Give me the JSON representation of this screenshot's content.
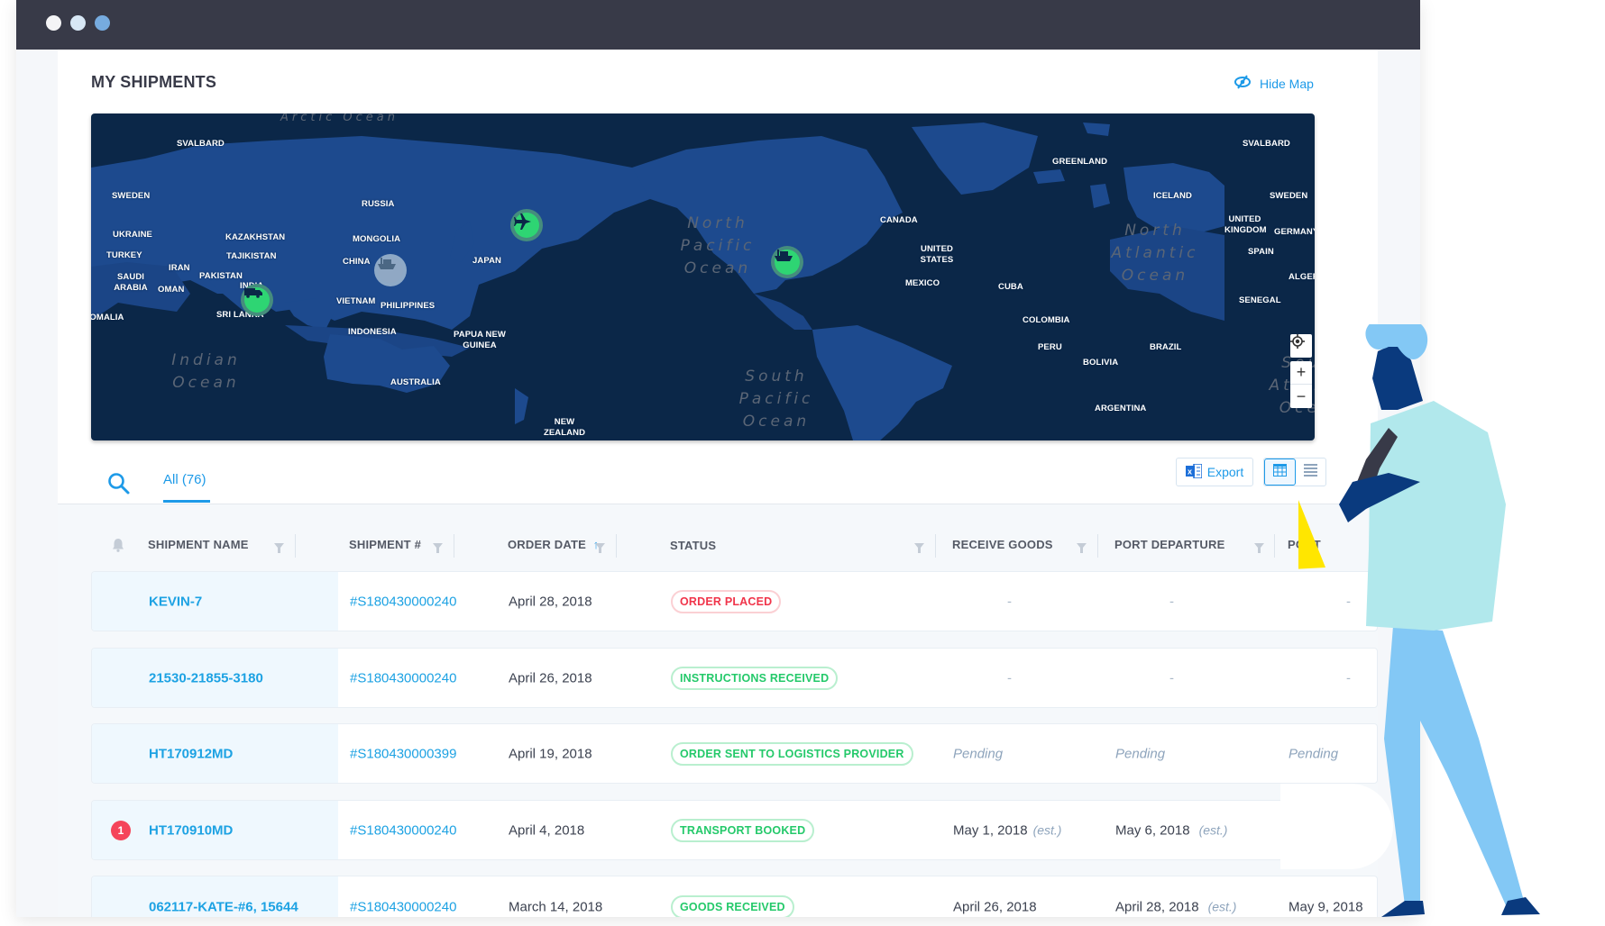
{
  "window": {
    "dots": [
      {
        "name": "window-dot-1",
        "color": "#f4f4f6"
      },
      {
        "name": "window-dot-2",
        "color": "#d7e7f5"
      },
      {
        "name": "window-dot-3",
        "color": "#76abdf"
      }
    ]
  },
  "header": {
    "title": "MY SHIPMENTS",
    "hide_map_label": "Hide Map",
    "hide_map_icon": "eye-slash-icon"
  },
  "map": {
    "country_labels": [
      "SVALBARD",
      "SWEDEN",
      "UKRAINE",
      "TURKEY",
      "IRAN",
      "SAUDI ARABIA",
      "OMAN",
      "SOMALIA",
      "KAZAKHSTAN",
      "TAJIKISTAN",
      "PAKISTAN",
      "INDIA",
      "SRI LANKA",
      "RUSSIA",
      "MONGOLIA",
      "CHINA",
      "JAPAN",
      "VIETNAM",
      "PHILIPPINES",
      "INDONESIA",
      "PAPUA NEW GUINEA",
      "AUSTRALIA",
      "NEW ZEALAND",
      "CANADA",
      "UNITED STATES",
      "MEXICO",
      "CUBA",
      "COLOMBIA",
      "PERU",
      "BOLIVIA",
      "BRAZIL",
      "ARGENTINA",
      "GREENLAND",
      "ICELAND",
      "SVALBARD",
      "SWEDEN",
      "UNITED KINGDOM",
      "GERMANY",
      "SPAIN",
      "ALGERIA",
      "SENEGAL"
    ],
    "ocean_labels": [
      "Arctic Ocean",
      "Indian Ocean",
      "North Pacific Ocean",
      "South Pacific Ocean",
      "North Atlantic Ocean",
      "South Atlantic Ocean"
    ],
    "markers": [
      {
        "type": "truck",
        "icon": "truck-icon",
        "state": "active",
        "near": "India"
      },
      {
        "type": "ship",
        "icon": "ship-icon",
        "state": "inactive",
        "near": "China"
      },
      {
        "type": "plane",
        "icon": "airplane-icon",
        "state": "active",
        "near": "Japan"
      },
      {
        "type": "ship",
        "icon": "ship-icon",
        "state": "active",
        "near": "North Pacific Ocean"
      }
    ],
    "controls": {
      "locate_icon": "crosshair-icon",
      "zoom_in": "+",
      "zoom_out": "−"
    }
  },
  "toolbar": {
    "search_icon": "search-icon",
    "tabs": [
      {
        "label": "All (76)",
        "active": true
      }
    ],
    "export_label": "Export",
    "export_icon": "excel-icon",
    "view_grid_icon": "grid-view-icon",
    "view_list_icon": "list-view-icon"
  },
  "table": {
    "columns": [
      "SHIPMENT NAME",
      "SHIPMENT #",
      "ORDER DATE",
      "STATUS",
      "RECEIVE GOODS",
      "PORT DEPARTURE",
      "PORT"
    ],
    "sort_indicator": "↑",
    "rows": [
      {
        "alert": null,
        "name": "KEVIN-7",
        "number": "#S180430000240",
        "order_date": "April 28, 2018",
        "status": "ORDER PLACED",
        "status_color": "red",
        "receive_goods": "-",
        "receive_est": "",
        "port_departure": "-",
        "port_departure_est": "",
        "port": "-"
      },
      {
        "alert": null,
        "name": "21530-21855-3180",
        "number": "#S180430000240",
        "order_date": "April 26, 2018",
        "status": "INSTRUCTIONS RECEIVED",
        "status_color": "green",
        "receive_goods": "-",
        "receive_est": "",
        "port_departure": "-",
        "port_departure_est": "",
        "port": "-"
      },
      {
        "alert": null,
        "name": "HT170912MD",
        "number": "#S180430000399",
        "order_date": "April 19, 2018",
        "status": "ORDER SENT TO LOGISTICS PROVIDER",
        "status_color": "green",
        "receive_goods": "Pending",
        "receive_est": "",
        "port_departure": "Pending",
        "port_departure_est": "",
        "port": "Pending"
      },
      {
        "alert": "1",
        "name": "HT170910MD",
        "number": "#S180430000240",
        "order_date": "April 4, 2018",
        "status": "TRANSPORT BOOKED",
        "status_color": "green",
        "receive_goods": "May 1, 2018",
        "receive_est": "(est.)",
        "port_departure": "May 6, 2018",
        "port_departure_est": "(est.)",
        "port": ""
      },
      {
        "alert": null,
        "name": "062117-KATE-#6, 15644",
        "number": "#S180430000240",
        "order_date": "March 14, 2018",
        "status": "GOODS RECEIVED",
        "status_color": "green",
        "receive_goods": "April 26, 2018",
        "receive_est": "",
        "port_departure": "April 28, 2018",
        "port_departure_est": "(est.)",
        "port": "May 9, 2018"
      }
    ]
  },
  "colors": {
    "accent": "#1d9ae8",
    "titlebar": "#383a48",
    "map_ocean": "#0b2748",
    "map_land": "#1d4d94",
    "marker_active": "#2ed573",
    "marker_inactive": "#90a8c4",
    "status_red": "#f0344a",
    "status_green": "#24c96a"
  }
}
